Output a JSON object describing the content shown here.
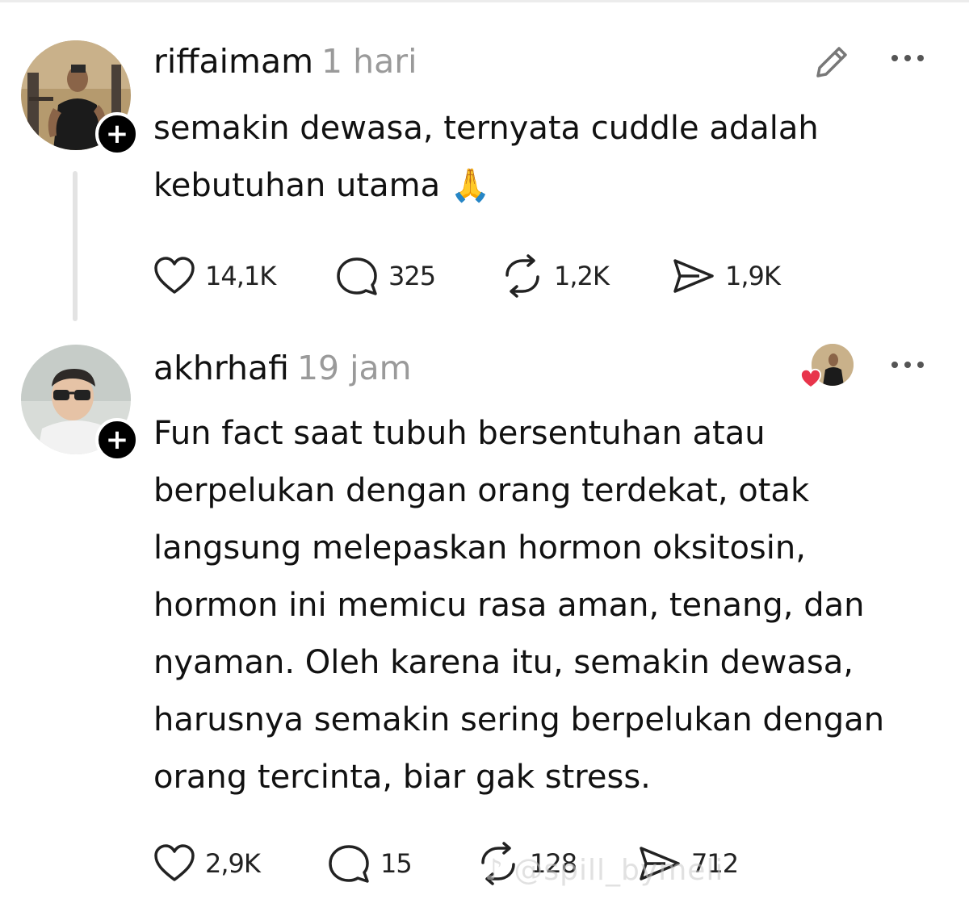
{
  "posts": [
    {
      "username": "riffaimam",
      "time": "1 hari",
      "text": "semakin dewasa, ternyata cuddle adalah kebutuhan utama 🙏",
      "stats": {
        "likes": "14,1K",
        "replies": "325",
        "reposts": "1,2K",
        "shares": "1,9K"
      },
      "follow_symbol": "+"
    },
    {
      "username": "akhrhafi",
      "time": "19 jam",
      "text": "Fun fact saat tubuh bersentuhan atau berpelukan dengan orang terdekat, otak langsung melepaskan hormon oksitosin, hormon ini memicu rasa aman, tenang, dan nyaman. Oleh karena itu, semakin dewasa, harusnya semakin sering berpelukan dengan orang tercinta, biar gak stress.",
      "stats": {
        "likes": "2,9K",
        "replies": "15",
        "reposts": "128",
        "shares": "712"
      },
      "follow_symbol": "+"
    }
  ],
  "watermark": "♪ @spill_bymeli",
  "icons": [
    "pencil-icon",
    "more-icon",
    "heart-icon",
    "reply-icon",
    "repost-icon",
    "share-icon",
    "liked-heart-icon"
  ],
  "colors": {
    "heart_badge": "#e8344b",
    "muted_text": "#9a9a9a"
  }
}
